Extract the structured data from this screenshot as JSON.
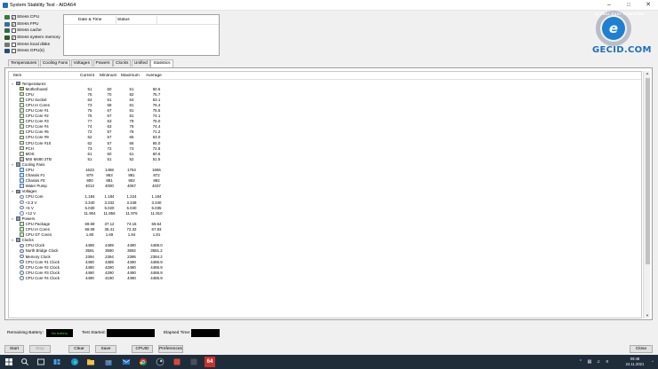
{
  "window": {
    "title": "System Stability Test - AIDA64"
  },
  "stress_options": [
    {
      "label": "Stress CPU",
      "checked": true,
      "icon": "cpu-icon",
      "color": "#3a7a3a"
    },
    {
      "label": "Stress FPU",
      "checked": true,
      "icon": "fpu-icon",
      "color": "#3a6ba8"
    },
    {
      "label": "Stress cache",
      "checked": false,
      "icon": "cache-icon",
      "color": "#2f6a4a"
    },
    {
      "label": "Stress system memory",
      "checked": true,
      "icon": "memory-icon",
      "color": "#2a5a2a"
    },
    {
      "label": "Stress local disks",
      "checked": false,
      "icon": "disk-icon",
      "color": "#777777"
    },
    {
      "label": "Stress GPU(s)",
      "checked": false,
      "icon": "gpu-icon",
      "color": "#2a4a80"
    }
  ],
  "log": {
    "col_datetime": "Date & Time",
    "col_status": "Status"
  },
  "logo": {
    "text": "GECID.COM",
    "arc": "GLOBAL EASY COMPUTER",
    "mark": "e",
    "colors": {
      "blue": "#1f7fd1",
      "ring": "#b9bdc6"
    }
  },
  "tabs": [
    "Temperatures",
    "Cooling Fans",
    "Voltages",
    "Powers",
    "Clocks",
    "Unified",
    "Statistics"
  ],
  "active_tab": "Statistics",
  "stats": {
    "headers": {
      "item": "Item",
      "current": "Current",
      "minimum": "Minimum",
      "maximum": "Maximum",
      "average": "Average"
    },
    "rows": [
      {
        "type": "cat",
        "name": "Temperatures",
        "icon": "thermometer-icon"
      },
      {
        "name": "Motherboard",
        "cur": "51",
        "min": "50",
        "max": "51",
        "avg": "50.6",
        "icon": "motherboard-icon"
      },
      {
        "name": "CPU",
        "cur": "75",
        "min": "70",
        "max": "82",
        "avg": "75.7",
        "icon": "cpu-icon"
      },
      {
        "name": "CPU Socket",
        "cur": "64",
        "min": "61",
        "max": "64",
        "avg": "63.1",
        "icon": "cpu-icon"
      },
      {
        "name": "CPU IA Cores",
        "cur": "73",
        "min": "68",
        "max": "81",
        "avg": "76.4",
        "icon": "cpu-icon"
      },
      {
        "name": "CPU Core #1",
        "cur": "75",
        "min": "67",
        "max": "81",
        "avg": "75.5",
        "icon": "cpu-icon"
      },
      {
        "name": "CPU Core #2",
        "cur": "75",
        "min": "67",
        "max": "81",
        "avg": "74.1",
        "icon": "cpu-icon"
      },
      {
        "name": "CPU Core #3",
        "cur": "77",
        "min": "63",
        "max": "78",
        "avg": "75.0",
        "icon": "cpu-icon"
      },
      {
        "name": "CPU Core #4",
        "cur": "74",
        "min": "63",
        "max": "78",
        "avg": "74.4",
        "icon": "cpu-icon"
      },
      {
        "name": "CPU Core #5",
        "cur": "72",
        "min": "57",
        "max": "78",
        "avg": "71.2",
        "icon": "cpu-icon"
      },
      {
        "name": "CPU Core #9",
        "cur": "62",
        "min": "57",
        "max": "65",
        "avg": "63.0",
        "icon": "cpu-icon"
      },
      {
        "name": "CPU Core #10",
        "cur": "62",
        "min": "57",
        "max": "66",
        "avg": "65.0",
        "icon": "cpu-icon"
      },
      {
        "name": "PCH",
        "cur": "73",
        "min": "72",
        "max": "73",
        "avg": "72.8",
        "icon": "chip-icon"
      },
      {
        "name": "MOS",
        "cur": "61",
        "min": "60",
        "max": "61",
        "avg": "60.6",
        "icon": "chip-icon"
      },
      {
        "name": "MSI M480 2TB",
        "cur": "51",
        "min": "51",
        "max": "52",
        "avg": "51.5",
        "icon": "drive-icon"
      },
      {
        "type": "cat",
        "name": "Cooling Fans",
        "icon": "fan-icon"
      },
      {
        "name": "CPU",
        "cur": "1623",
        "min": "1468",
        "max": "1754",
        "avg": "1656",
        "icon": "fan-icon"
      },
      {
        "name": "Chassis #1",
        "cur": "879",
        "min": "863",
        "max": "881",
        "avg": "872",
        "icon": "fan-icon"
      },
      {
        "name": "Chassis #3",
        "cur": "900",
        "min": "881",
        "max": "902",
        "avg": "892",
        "icon": "fan-icon"
      },
      {
        "name": "Water Pump",
        "cur": "4013",
        "min": "4000",
        "max": "4067",
        "avg": "4037",
        "icon": "pump-icon"
      },
      {
        "type": "cat",
        "name": "Voltages",
        "icon": "voltage-icon"
      },
      {
        "name": "CPU Core",
        "cur": "1.184",
        "min": "1.184",
        "max": "1.224",
        "avg": "1.184",
        "icon": "voltage-icon"
      },
      {
        "name": "+3.3 V",
        "cur": "3.340",
        "min": "3.332",
        "max": "3.348",
        "avg": "3.340",
        "icon": "voltage-icon"
      },
      {
        "name": "+5 V",
        "cur": "5.030",
        "min": "5.020",
        "max": "5.040",
        "avg": "5.035",
        "icon": "voltage-icon"
      },
      {
        "name": "+12 V",
        "cur": "11.904",
        "min": "11.856",
        "max": "11.976",
        "avg": "11.910",
        "icon": "voltage-icon"
      },
      {
        "type": "cat",
        "name": "Powers",
        "icon": "power-icon"
      },
      {
        "name": "CPU Package",
        "cur": "69.69",
        "min": "37.12",
        "max": "74.16",
        "avg": "69.64",
        "icon": "power-icon"
      },
      {
        "name": "CPU IA Cores",
        "cur": "68.08",
        "min": "35.41",
        "max": "72.32",
        "avg": "67.83",
        "icon": "power-icon"
      },
      {
        "name": "CPU GT Cores",
        "cur": "1.80",
        "min": "1.69",
        "max": "1.84",
        "avg": "1.81",
        "icon": "power-icon"
      },
      {
        "type": "cat",
        "name": "Clocks",
        "icon": "clock-icon"
      },
      {
        "name": "CPU Clock",
        "cur": "4489",
        "min": "4489",
        "max": "4490",
        "avg": "4489.0",
        "icon": "clock-icon"
      },
      {
        "name": "North Bridge Clock",
        "cur": "3591",
        "min": "3590",
        "max": "3592",
        "avg": "3591.2",
        "icon": "clock-icon"
      },
      {
        "name": "Memory Clock",
        "cur": "2394",
        "min": "2394",
        "max": "2395",
        "avg": "2394.2",
        "icon": "clock-icon"
      },
      {
        "name": "CPU Core #1 Clock",
        "cur": "4490",
        "min": "4389",
        "max": "4490",
        "avg": "4486.9",
        "icon": "clock-icon"
      },
      {
        "name": "CPU Core #2 Clock",
        "cur": "4490",
        "min": "4290",
        "max": "4490",
        "avg": "4486.9",
        "icon": "clock-icon"
      },
      {
        "name": "CPU Core #3 Clock",
        "cur": "4490",
        "min": "4290",
        "max": "4490",
        "avg": "4486.9",
        "icon": "clock-icon"
      },
      {
        "name": "CPU Core #4 Clock",
        "cur": "4490",
        "min": "4190",
        "max": "4490",
        "avg": "4485.9",
        "icon": "clock-icon"
      }
    ]
  },
  "status": {
    "remaining_battery_label": "Remaining Battery:",
    "remaining_battery_value": "No battery",
    "test_started_label": "Test Started:",
    "elapsed_time_label": "Elapsed Time:"
  },
  "buttons": {
    "start": "Start",
    "stop": "Stop",
    "clear": "Clear",
    "save": "Save",
    "cpuid": "CPUID",
    "preferences": "Preferences",
    "close": "Close"
  },
  "taskbar": {
    "time": "09:48",
    "date": "24.11.2021",
    "app_badge": "64",
    "colors": {
      "bg": "#1f2d3b"
    }
  }
}
